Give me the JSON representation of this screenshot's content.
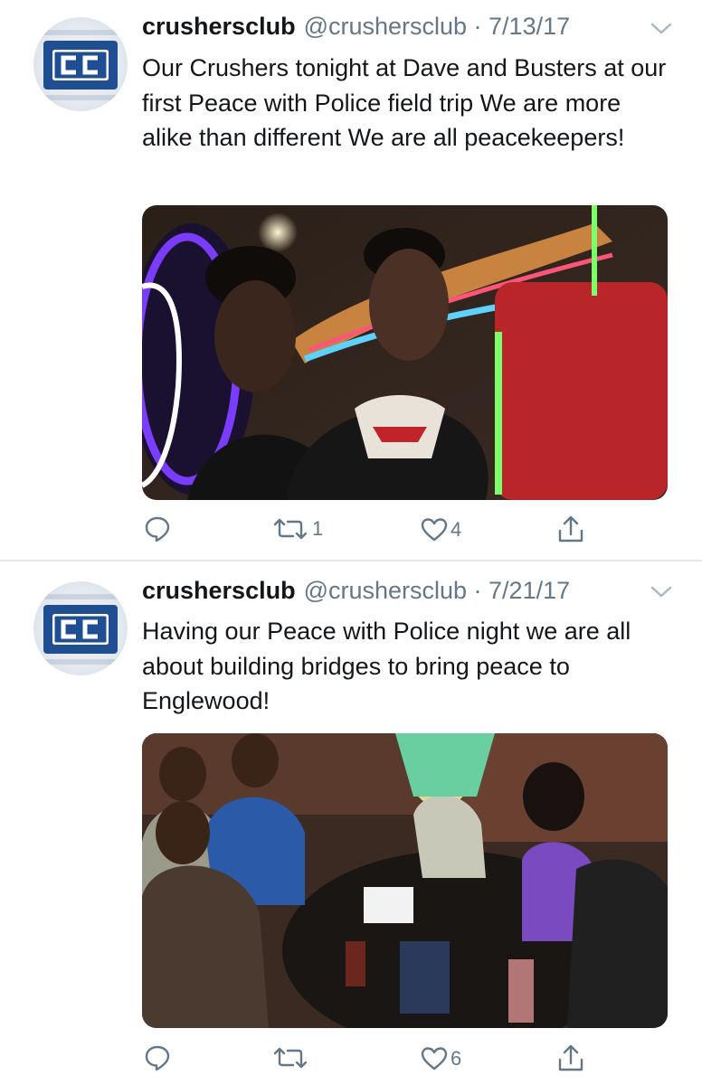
{
  "tweets": [
    {
      "author_name": "crushersclub",
      "meta": "@crushersclub · 7/13/17",
      "text": "Our Crushers tonight at Dave and Busters at our first Peace with Police field trip We are more alike than different We are all peacekeepers!",
      "retweets": "1",
      "likes": "4"
    },
    {
      "author_name": "crushersclub",
      "meta": "@crushersclub · 7/21/17",
      "text": "Having our Peace with Police night we are all about building bridges to bring peace to Englewood!",
      "retweets": "",
      "likes": "6"
    }
  ],
  "avatar_logo_text": "CC",
  "colors": {
    "text": "#14171a",
    "secondary": "#657786",
    "divider": "#e1e8ed",
    "avatar_blue": "#1f4f92"
  },
  "icons": [
    "reply-icon",
    "retweet-icon",
    "like-icon",
    "share-icon",
    "chevron-down-icon"
  ]
}
